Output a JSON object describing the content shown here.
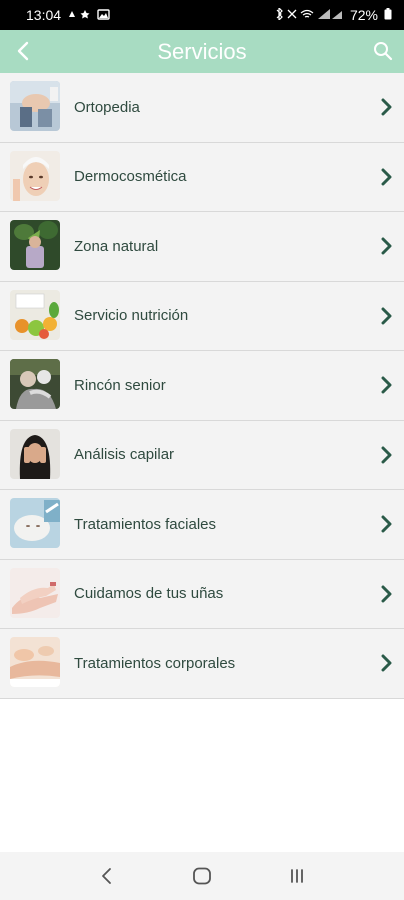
{
  "status_bar": {
    "time": "13:04",
    "battery": "72%",
    "left_icons": [
      "notification-icon",
      "gear-icon",
      "image-icon"
    ],
    "right_icons": [
      "bluetooth-icon",
      "mute-icon",
      "wifi-icon",
      "signal-icon",
      "battery-icon"
    ]
  },
  "header": {
    "title": "Servicios",
    "back_icon": "back-arrow-icon",
    "search_icon": "search-icon",
    "background": "#a8dcc2"
  },
  "services": {
    "items": [
      {
        "label": "Ortopedia",
        "thumb": "ortopedia-thumbnail"
      },
      {
        "label": "Dermocosmética",
        "thumb": "dermocosmetica-thumbnail"
      },
      {
        "label": "Zona natural",
        "thumb": "zona-natural-thumbnail"
      },
      {
        "label": "Servicio nutrición",
        "thumb": "nutricion-thumbnail"
      },
      {
        "label": "Rincón senior",
        "thumb": "senior-thumbnail"
      },
      {
        "label": "Análisis capilar",
        "thumb": "capilar-thumbnail"
      },
      {
        "label": "Tratamientos faciales",
        "thumb": "faciales-thumbnail"
      },
      {
        "label": "Cuidamos de tus uñas",
        "thumb": "unas-thumbnail"
      },
      {
        "label": "Tratamientos corporales",
        "thumb": "corporales-thumbnail"
      }
    ],
    "chevron_color": "#2a5a48"
  },
  "nav_bar": {
    "buttons": [
      "back-nav-icon",
      "home-nav-icon",
      "recents-nav-icon"
    ]
  }
}
